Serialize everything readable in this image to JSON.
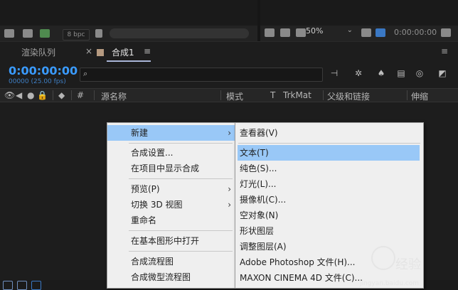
{
  "top_toolbar": {
    "bpc_label": "8 bpc",
    "zoom_value": "50%",
    "timecode_small": "0:00:00:00"
  },
  "tabs": {
    "render_queue": "渲染队列",
    "close_symbol": "×",
    "comp_tab": "合成1",
    "comp_menu": "≡",
    "panel_menu": "≡"
  },
  "timeline": {
    "timecode": "0:00:00:00",
    "fps": "00000 (25.00 fps)",
    "search_icon": "search-icon"
  },
  "columns": {
    "hash": "#",
    "source_name": "源名称",
    "mode": "模式",
    "t": "T",
    "trkmat": "TrkMat",
    "parent": "父级和链接",
    "stretch": "伸缩"
  },
  "context_menu": {
    "items": [
      {
        "label": "新建",
        "submenu": true,
        "highlighted": true
      },
      {
        "label": "合成设置...",
        "submenu": false
      },
      {
        "label": "在项目中显示合成",
        "submenu": false
      },
      {
        "label": "预览(P)",
        "submenu": true
      },
      {
        "label": "切换 3D 视图",
        "submenu": true
      },
      {
        "label": "重命名",
        "submenu": false
      },
      {
        "label": "在基本图形中打开",
        "submenu": false
      },
      {
        "label": "合成流程图",
        "submenu": false
      },
      {
        "label": "合成微型流程图",
        "submenu": false
      }
    ],
    "arrow": "›"
  },
  "submenu": {
    "items": [
      {
        "label": "查看器(V)"
      },
      {
        "label": "文本(T)",
        "highlighted": true
      },
      {
        "label": "纯色(S)..."
      },
      {
        "label": "灯光(L)..."
      },
      {
        "label": "摄像机(C)..."
      },
      {
        "label": "空对象(N)"
      },
      {
        "label": "形状图层"
      },
      {
        "label": "调整图层(A)"
      },
      {
        "label": "Adobe Photoshop 文件(H)..."
      },
      {
        "label": "MAXON CINEMA 4D 文件(C)..."
      }
    ]
  },
  "watermark": {
    "text": "经验",
    "sub": "jingyan.baidu.com"
  },
  "colors": {
    "accent_blue": "#3a9bff",
    "highlight": "#99c8f7",
    "menu_bg": "#efefef"
  }
}
